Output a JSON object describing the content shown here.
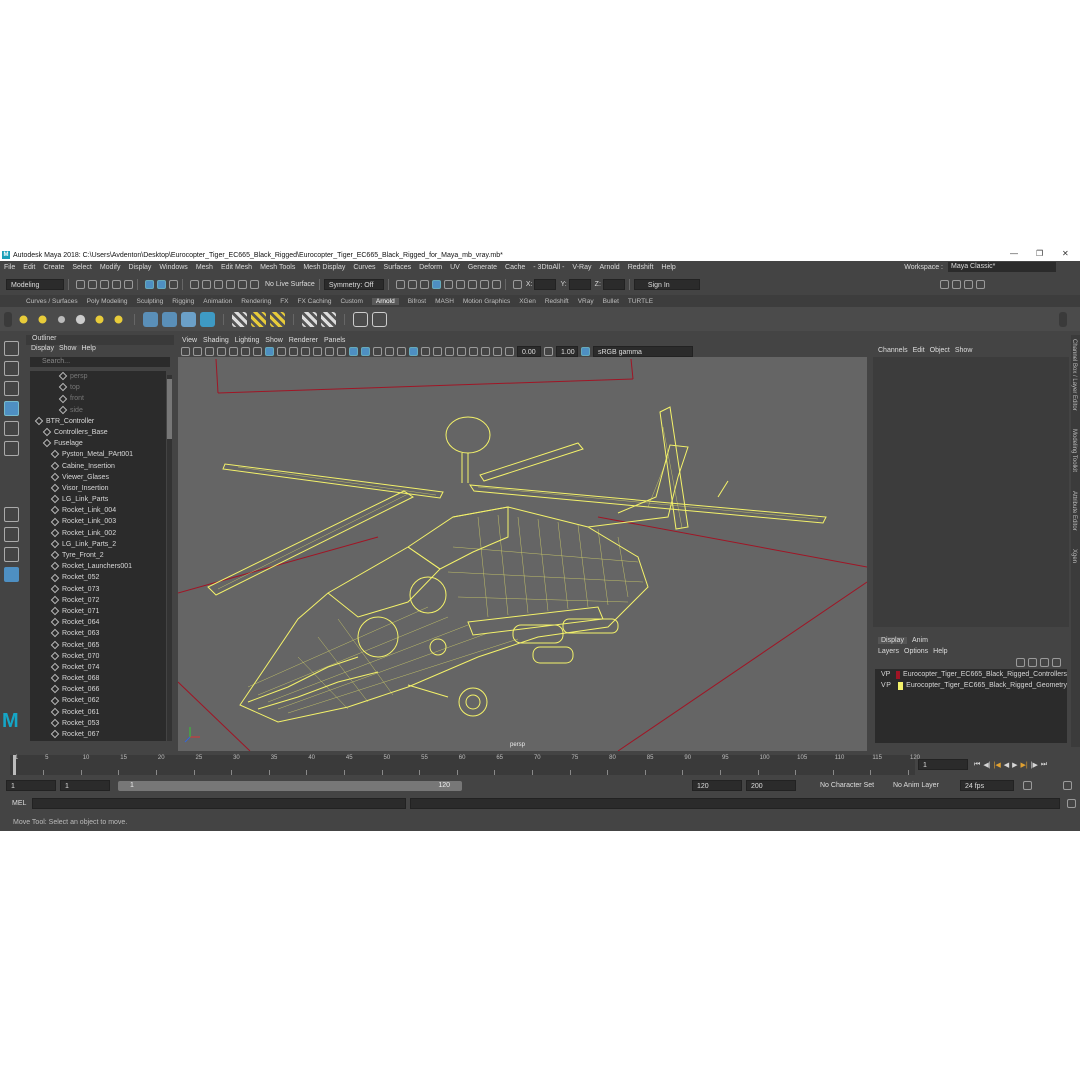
{
  "window": {
    "title": "Autodesk Maya 2018: C:\\Users\\Avdenton\\Desktop\\Eurocopter_Tiger_EC665_Black_Rigged\\Eurocopter_Tiger_EC665_Black_Rigged_for_Maya_mb_vray.mb*"
  },
  "menubar": {
    "items": [
      "File",
      "Edit",
      "Create",
      "Select",
      "Modify",
      "Display",
      "Windows",
      "Mesh",
      "Edit Mesh",
      "Mesh Tools",
      "Mesh Display",
      "Curves",
      "Surfaces",
      "Deform",
      "UV",
      "Generate",
      "Cache",
      "- 3DtoAll -",
      "V-Ray",
      "Arnold",
      "Redshift",
      "Help"
    ],
    "workspace_label": "Workspace :",
    "workspace_value": "Maya Classic*"
  },
  "statusline": {
    "mode": "Modeling",
    "live_surface": "No Live Surface",
    "symmetry": "Symmetry: Off",
    "x_label": "X:",
    "y_label": "Y:",
    "z_label": "Z:",
    "sign_in": "Sign In"
  },
  "shelf": {
    "tabs": [
      "Curves / Surfaces",
      "Poly Modeling",
      "Sculpting",
      "Rigging",
      "Animation",
      "Rendering",
      "FX",
      "FX Caching",
      "Custom",
      "Arnold",
      "Bifrost",
      "MASH",
      "Motion Graphics",
      "XGen",
      "Redshift",
      "VRay",
      "Bullet",
      "TURTLE"
    ],
    "active": "Arnold"
  },
  "outliner": {
    "title": "Outliner",
    "menu": [
      "Display",
      "Show",
      "Help"
    ],
    "search_placeholder": "Search...",
    "items": [
      {
        "label": "persp",
        "dim": true
      },
      {
        "label": "top",
        "dim": true
      },
      {
        "label": "front",
        "dim": true
      },
      {
        "label": "side",
        "dim": true
      },
      {
        "label": "BTR_Controller",
        "dim": false
      },
      {
        "label": "Controllers_Base",
        "dim": false
      },
      {
        "label": "Fuselage",
        "dim": false
      },
      {
        "label": "Pyston_Metal_PArt001",
        "dim": false
      },
      {
        "label": "Cabine_Insertion",
        "dim": false
      },
      {
        "label": "Viewer_Glases",
        "dim": false
      },
      {
        "label": "Visor_Insertion",
        "dim": false
      },
      {
        "label": "LG_Link_Parts",
        "dim": false
      },
      {
        "label": "Rocket_Link_004",
        "dim": false
      },
      {
        "label": "Rocket_Link_003",
        "dim": false
      },
      {
        "label": "Rocket_Link_002",
        "dim": false
      },
      {
        "label": "LG_Link_Parts_2",
        "dim": false
      },
      {
        "label": "Tyre_Front_2",
        "dim": false
      },
      {
        "label": "Rocket_Launchers001",
        "dim": false
      },
      {
        "label": "Rocket_052",
        "dim": false
      },
      {
        "label": "Rocket_073",
        "dim": false
      },
      {
        "label": "Rocket_072",
        "dim": false
      },
      {
        "label": "Rocket_071",
        "dim": false
      },
      {
        "label": "Rocket_064",
        "dim": false
      },
      {
        "label": "Rocket_063",
        "dim": false
      },
      {
        "label": "Rocket_065",
        "dim": false
      },
      {
        "label": "Rocket_070",
        "dim": false
      },
      {
        "label": "Rocket_074",
        "dim": false
      },
      {
        "label": "Rocket_068",
        "dim": false
      },
      {
        "label": "Rocket_066",
        "dim": false
      },
      {
        "label": "Rocket_062",
        "dim": false
      },
      {
        "label": "Rocket_061",
        "dim": false
      },
      {
        "label": "Rocket_053",
        "dim": false
      },
      {
        "label": "Rocket_067",
        "dim": false
      }
    ]
  },
  "viewport": {
    "menu": [
      "View",
      "Shading",
      "Lighting",
      "Show",
      "Renderer",
      "Panels"
    ],
    "exposure": "0.00",
    "gamma": "1.00",
    "color_space": "sRGB gamma",
    "camera_label": "persp"
  },
  "channel_box": {
    "menu": [
      "Channels",
      "Edit",
      "Object",
      "Show"
    ]
  },
  "layer_editor": {
    "tabs": [
      "Display",
      "Anim"
    ],
    "menu": [
      "Layers",
      "Options",
      "Help"
    ],
    "layers": [
      {
        "v": "V",
        "p": "P",
        "color": "#a01525",
        "name": "Eurocopter_Tiger_EC665_Black_Rigged_Controllers"
      },
      {
        "v": "V",
        "p": "P",
        "color": "#f4f26a",
        "name": "Eurocopter_Tiger_EC665_Black_Rigged_Geometry"
      }
    ]
  },
  "side_tabs": [
    "Channel Box / Layer Editor",
    "Modeling Toolkit",
    "Attribute Editor",
    "Xgen"
  ],
  "timeline": {
    "ticks": [
      "1",
      "5",
      "10",
      "15",
      "20",
      "25",
      "30",
      "35",
      "40",
      "45",
      "50",
      "55",
      "60",
      "65",
      "70",
      "75",
      "80",
      "85",
      "90",
      "95",
      "100",
      "105",
      "110",
      "115",
      "120"
    ],
    "current_frame": "1"
  },
  "range": {
    "start": "1",
    "playback_start": "1",
    "slider_start": "1",
    "slider_end": "120",
    "playback_end": "120",
    "end": "200",
    "character_set": "No Character Set",
    "anim_layer": "No Anim Layer",
    "fps": "24 fps"
  },
  "command_line": {
    "label": "MEL"
  },
  "help_line": {
    "text": "Move Tool: Select an object to move."
  },
  "colors": {
    "wireframe": "#f4f26a",
    "grid_line": "#a01525",
    "viewport_bg": "#656565"
  }
}
